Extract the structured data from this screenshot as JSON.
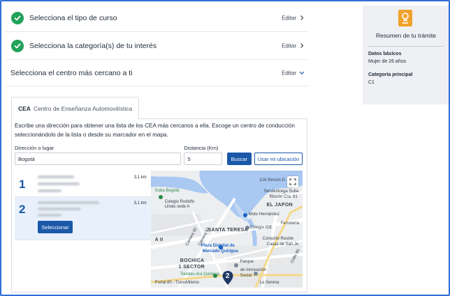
{
  "steps": [
    {
      "title": "Selecciona el tipo de curso",
      "edit": "Editar"
    },
    {
      "title": "Selecciona la categoría(s) de tu interés",
      "edit": "Editar"
    },
    {
      "title": "Selecciona el centro más cercano a ti",
      "edit": "Editar"
    }
  ],
  "tab": {
    "abbr": "CEA",
    "label": "Centro de Enseñanza Automovilística"
  },
  "description": "Escribe una dirección para obtener una lista de los CEA más cercanos a ella. Escoge un centro de conducción seleccionándolo de la lista o desde su marcador en el mapa.",
  "form": {
    "address_label": "Dirección o lugar",
    "address_value": "Bogotá",
    "distance_label": "Distancia (Km)",
    "distance_value": "5",
    "search_label": "Buscar",
    "location_label": "Usar mi ubicación"
  },
  "results": [
    {
      "number": "1",
      "distance": "3,1 km"
    },
    {
      "number": "2",
      "distance": "3,1 km",
      "select_label": "Seleccionar"
    }
  ],
  "map": {
    "labels": {
      "cai_rincon": "CAI Rincón D",
      "servientrega": "Servientrega Suba",
      "rincon_cra": "Rincón Cra. 91",
      "el_japon": "EL JAPON",
      "suba_bogota": "Suba Bogotá",
      "colegio": "Colegio Rodolfo",
      "colegio2": "Llinás sede A",
      "carrera_92": "Carrera 92",
      "carrera_93": "Carrera 93",
      "santa_teresa": "SANTA TERESA",
      "mi_ii": "A II",
      "moto_hernandez": "Moto Hernández",
      "colegio_ide": "Colegio IDE",
      "ferreteria": "Ferretería",
      "conjunto": "Conjunto Reside",
      "casas": "Casas de San Ju",
      "plaza": "Plaza Distrital de",
      "mercado": "Mercado Quirigua",
      "bochica": "BOCHICA",
      "sector": "1 SECTOR",
      "parque": "Parque",
      "innovacion": "de Innovación",
      "social": "Social",
      "tiendas": "Tiendas Ara Quirigua",
      "portal": "Portal 80 - TransMilenio",
      "la_serena": "La Serena",
      "calle80": "Calle 80"
    },
    "marker_number": "2"
  },
  "summary": {
    "title": "Resumen de tu trámite",
    "basic_label": "Datos básicos",
    "basic_value": "Mujer de 26 años",
    "category_label": "Categoría principal",
    "category_value": "C1"
  },
  "colors": {
    "primary": "#1b58a8",
    "success": "#23a25a",
    "accent": "#f0a22e",
    "water": "#a9c8f2"
  }
}
